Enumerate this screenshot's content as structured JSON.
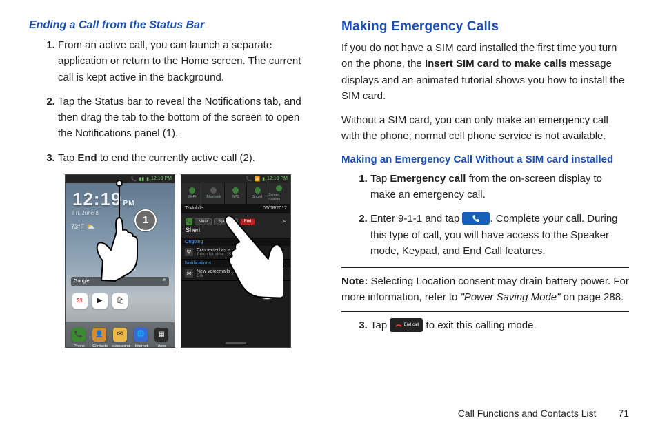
{
  "left": {
    "subheading": "Ending a Call from the Status Bar",
    "steps": [
      {
        "pre": "From an active call, you can launch a separate application or return to the Home screen. The current call is kept active in the background."
      },
      {
        "pre": "Tap the Status bar to reveal the Notifications tab, and then drag the tab to the bottom of the screen to open the Notifications panel (1)."
      },
      {
        "pre": "Tap ",
        "bold": "End",
        "post": " to end the currently active call (2)."
      }
    ],
    "illus": {
      "badge1": "1",
      "badge2": "2",
      "home": {
        "status_time": "12:19 PM",
        "clock_time": "12:19",
        "clock_ampm": "PM",
        "clock_date": "Fri, June 8",
        "temp": "73°F",
        "dock_labels": [
          "Phone",
          "Contacts",
          "Messaging",
          "Internet",
          "Apps"
        ],
        "app_icons": [
          "G",
          "📅",
          "▶",
          "🛍"
        ],
        "calendar_day": "31"
      },
      "panel": {
        "status_time": "12:19 PM",
        "toggle_labels": [
          "Wi-Fi",
          "Bluetooth",
          "GPS",
          "Sound",
          "Screen rotation"
        ],
        "carrier": "T-Mobile",
        "date": "06/08/2012",
        "call_name": "Sheri",
        "btn_mute": "Mute",
        "btn_speaker": "Speaker",
        "btn_end": "End",
        "ongoing": "Ongoing",
        "row1_title": "Connected as a media device",
        "row1_sub": "Touch for other USB options",
        "notifications": "Notifications",
        "row2_title": "New voicemails (1)",
        "row2_sub": "Dial"
      }
    }
  },
  "right": {
    "heading": "Making Emergency Calls",
    "p1_a": "If you do not have a SIM card installed the first time you turn on the phone, the ",
    "p1_bold": "Insert SIM card to make calls",
    "p1_b": " message displays and an animated tutorial shows you how to install the SIM card.",
    "p2": "Without a SIM card, you can only make an emergency call with the phone; normal cell phone service is not available.",
    "sub2": "Making an Emergency Call Without a SIM card installed",
    "steps12": [
      {
        "pre": "Tap ",
        "bold": "Emergency call",
        "post": " from the on-screen display to make an emergency call."
      },
      {
        "pre": "Enter 9-1-1 and tap ",
        "icon": "blue-handset",
        "post": ". Complete your call. During this type of call, you will have access to the Speaker mode, Keypad, and End Call features."
      }
    ],
    "note_label": "Note:",
    "note_body_a": " Selecting Location consent may drain battery power. For more information, refer to ",
    "note_italic": "\"Power Saving Mode\"",
    "note_body_b": "  on page 288.",
    "step3_pre": "Tap ",
    "step3_icon_label": "End call",
    "step3_post": " to exit this calling mode."
  },
  "footer": {
    "section": "Call Functions and Contacts List",
    "page": "71"
  }
}
